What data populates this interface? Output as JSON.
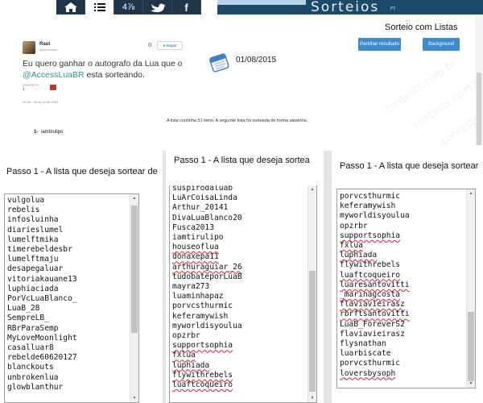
{
  "nav": {
    "items": [
      {
        "id": "home",
        "icon": "home-icon",
        "label": ""
      },
      {
        "id": "list",
        "icon": "list-icon",
        "label": ""
      },
      {
        "id": "numbers",
        "icon": "numbers-icon",
        "label": "4⅞"
      },
      {
        "id": "twitter",
        "icon": "twitter-bird-icon",
        "label": ""
      },
      {
        "id": "facebook",
        "icon": "facebook-icon",
        "label": "f"
      }
    ],
    "brand": "Sorteios",
    "brand_sub": "PT"
  },
  "header": {
    "title": "Sorteio com Listas",
    "share_button": "Partilhar resultado",
    "background_button": "Background"
  },
  "tweet": {
    "name": "Raul",
    "handle": "@iamtirulipo",
    "follow_label": "Seguir",
    "text_before": "Eu quero ganhar o autografo da Lua que o ",
    "mention": "@AccessLuaBR",
    "text_after": " esta sorteando.",
    "stat_label": "FAVORITO",
    "stat_value": "1",
    "timestamp": "22:44 - 29 de jul de 2015"
  },
  "draw": {
    "date": "01/08/2015",
    "info": "A lista continha 51 itens. A seguinte lista foi sorteada de forma aleatória.",
    "result_index": "1-",
    "result_name": "iamtirulipo"
  },
  "watermark": "contests.com.br",
  "colors": {
    "nav_bg": "#1e3647",
    "brand_bg": "#1b4a69",
    "button_blue": "#3d8ad0",
    "mention_teal": "#2a9a8e"
  },
  "panels": [
    {
      "title": "Passo 1 - A lista que deseja sortear de",
      "items": [
        "vulgolua",
        "rebelis",
        "infosluinha",
        "diarieslumel",
        "lumelftmika",
        "timerebeldesbr",
        "lumelftmaju",
        "desapegaluar",
        "vitoriakauane13",
        "luphiaciada",
        "PorVcLuaBlanco_",
        "LuaB_28",
        "SempreLB_",
        "RBrParaSemp",
        "MyLoveMoonlight",
        "casalluar8",
        "rebelde60620127",
        "blanckouts",
        "unbrokenlua",
        "glowblanthur"
      ],
      "misspelled": []
    },
    {
      "title": "Passo 1 - A lista que deseja sortea",
      "items": [
        "suspirodaluab",
        "LuArCoisaLinda",
        "Arthur_20141",
        "DivaLuaBlanco20",
        "Fusca2013",
        "iamtirulipo",
        "houseoflua",
        "donaxepa11",
        "arthuraguiar_26",
        "tudobateporLuaB",
        "mayra273",
        "luaminhapaz",
        "porvcsthurmic",
        "keferamywish",
        "myworldisyoulua",
        "opzrbr",
        "supportsophia",
        "fxlua",
        "luphiada",
        "flywithrebels",
        "luaftcoqueiro"
      ],
      "misspelled": [
        6,
        7,
        8,
        16,
        17,
        18,
        19,
        20
      ]
    },
    {
      "title": "Passo 1 - A lista que deseja sortear",
      "items": [
        "porvcsthurmic",
        "keferamywish",
        "myworldisyoulua",
        "opzrbr",
        "supportsophia",
        "fxlua",
        "luphiada",
        "flywithrebels",
        "luaftcoqueiro",
        "luaresantovitti",
        "_marinagcosta",
        "flaviavieirasz",
        "rbrftsantovitti",
        "LuaB_ForeverS2",
        "flaviavieirasz",
        "flysnathan",
        "luarbiscate",
        "porvcsthurmic",
        "loversbysoph"
      ],
      "misspelled": [
        4,
        5,
        6,
        8,
        9,
        10,
        11,
        12,
        18
      ]
    }
  ]
}
